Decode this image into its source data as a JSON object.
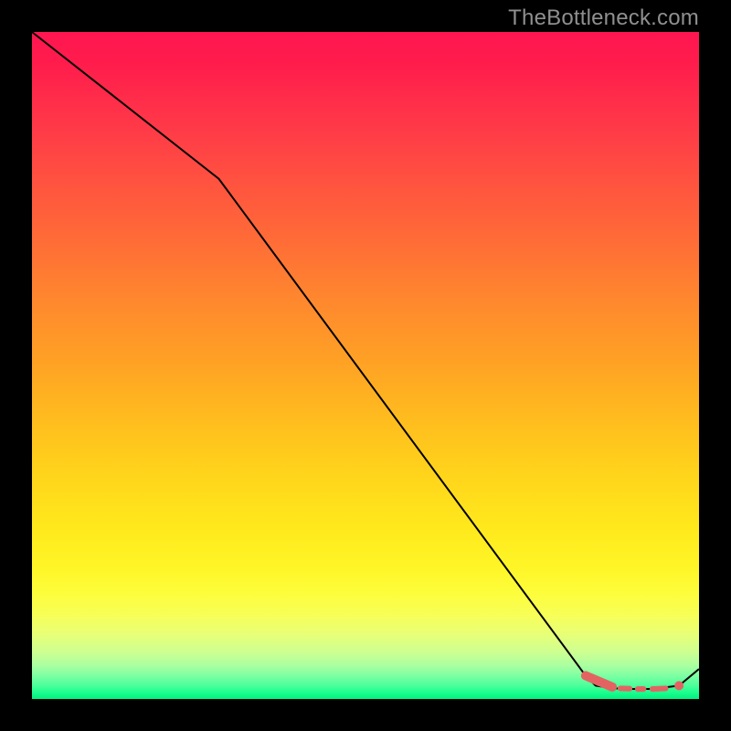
{
  "watermark": "TheBottleneck.com",
  "chart_data": {
    "type": "line",
    "title": "",
    "xlabel": "",
    "ylabel": "",
    "xlim": [
      0,
      100
    ],
    "ylim": [
      0,
      100
    ],
    "series": [
      {
        "name": "bottleneck-curve",
        "x": [
          0,
          28,
          83,
          84.5,
          87,
          90,
          93,
          97,
          100
        ],
        "y": [
          100,
          78,
          3.5,
          2,
          1.6,
          1.5,
          1.5,
          2,
          4.5
        ],
        "stroke": "#000000",
        "stroke_width": 2
      }
    ],
    "markers": [
      {
        "name": "slider-highlight",
        "p0": {
          "x": 83,
          "y": 3.5
        },
        "p1": {
          "x": 87,
          "y": 1.8
        },
        "thick": 10,
        "color": "#e36363"
      },
      {
        "name": "slider-seg-1",
        "p0": {
          "x": 88.2,
          "y": 1.6
        },
        "p1": {
          "x": 89.6,
          "y": 1.55
        },
        "thick": 6,
        "color": "#e36363"
      },
      {
        "name": "slider-seg-2",
        "p0": {
          "x": 90.8,
          "y": 1.5
        },
        "p1": {
          "x": 91.7,
          "y": 1.5
        },
        "thick": 6,
        "color": "#e36363"
      },
      {
        "name": "slider-seg-3",
        "p0": {
          "x": 93.0,
          "y": 1.5
        },
        "p1": {
          "x": 95.0,
          "y": 1.6
        },
        "thick": 6,
        "color": "#e36363"
      },
      {
        "name": "slider-dot",
        "p0": {
          "x": 97.0,
          "y": 2.0
        },
        "r": 5,
        "color": "#e36363"
      }
    ],
    "gradient_stops": [
      {
        "pos": 0,
        "color": "#ff1651"
      },
      {
        "pos": 22,
        "color": "#ff5140"
      },
      {
        "pos": 49,
        "color": "#ffa025"
      },
      {
        "pos": 74,
        "color": "#ffe81c"
      },
      {
        "pos": 90,
        "color": "#e6ff79"
      },
      {
        "pos": 100,
        "color": "#00f080"
      }
    ]
  }
}
